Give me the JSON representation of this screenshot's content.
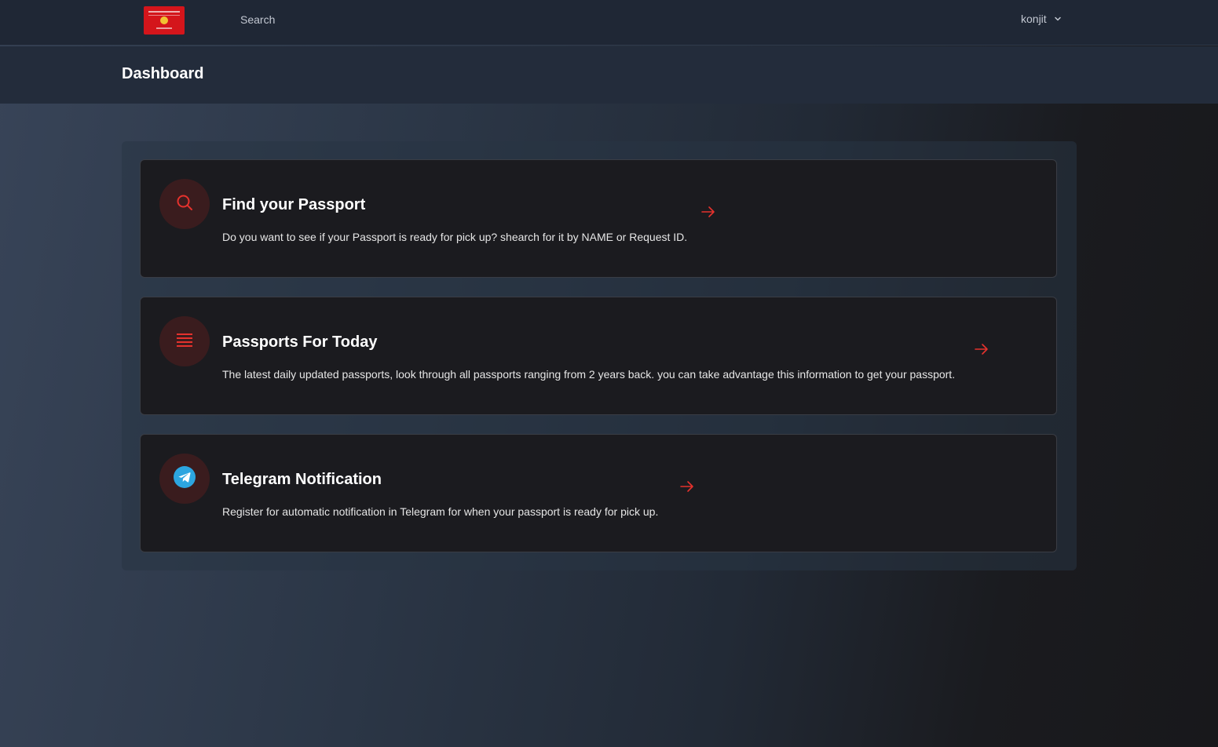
{
  "nav": {
    "logo_icon": "passport-logo",
    "search_label": "Search",
    "user_name": "konjit"
  },
  "header": {
    "title": "Dashboard"
  },
  "colors": {
    "accent": "#e5322d",
    "telegram": "#2ca5e0"
  },
  "cards": [
    {
      "icon": "search-icon",
      "title": "Find your Passport",
      "description": "Do you want to see if your Passport is ready for pick up? shearch for it by NAME or Request ID."
    },
    {
      "icon": "list-icon",
      "title": "Passports For Today",
      "description": "The latest daily updated passports, look through all passports ranging from 2 years back. you can take advantage this information to get your passport."
    },
    {
      "icon": "telegram-icon",
      "title": "Telegram Notification",
      "description": "Register for automatic notification in Telegram for when your passport is ready for pick up."
    }
  ]
}
